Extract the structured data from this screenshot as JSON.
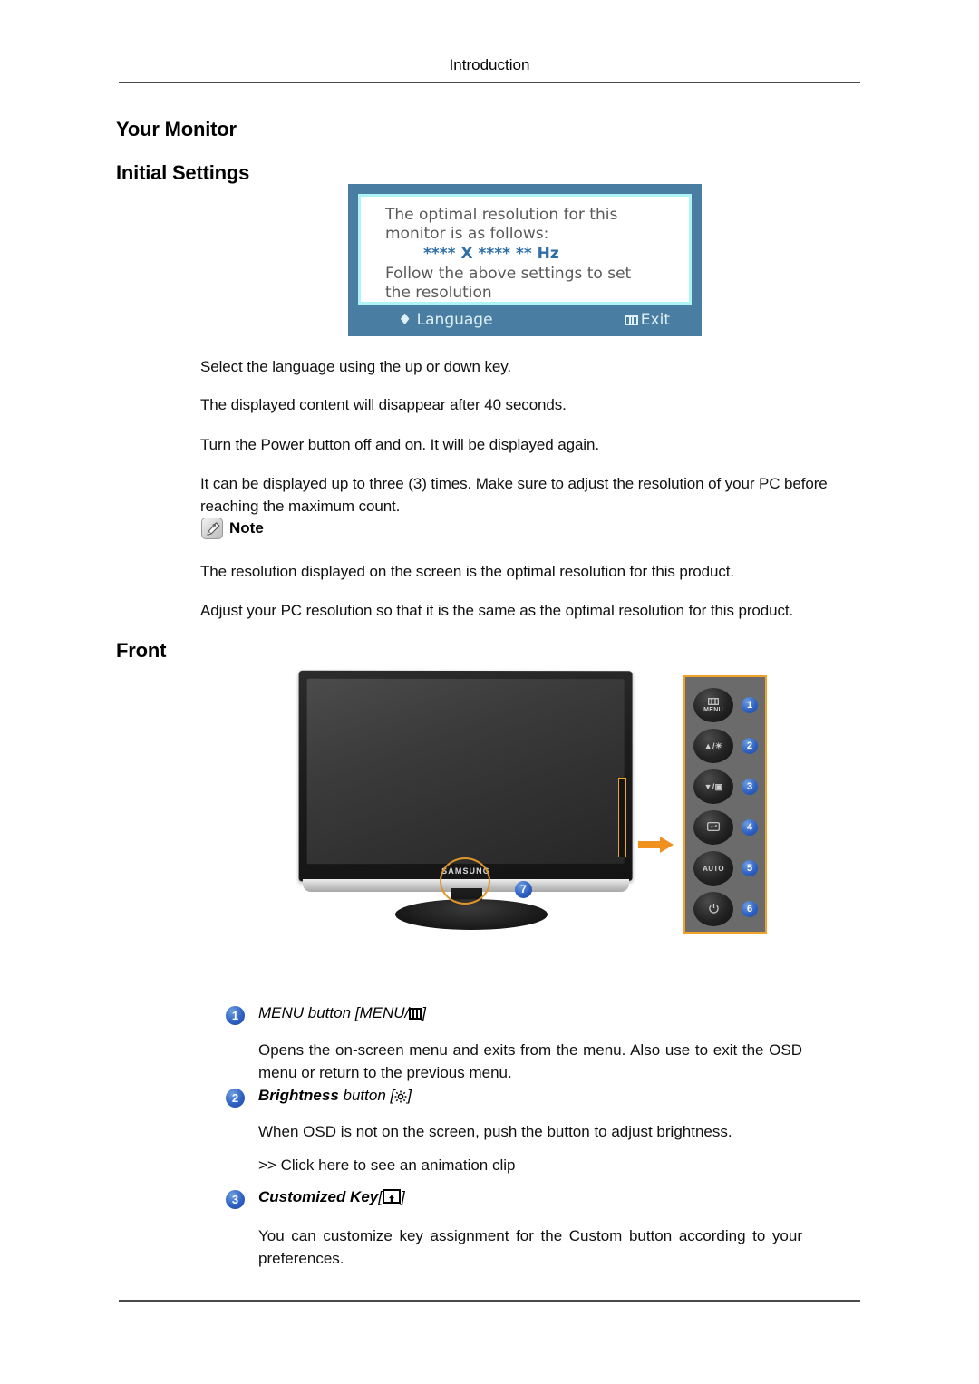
{
  "header": {
    "running_title": "Introduction"
  },
  "headings": {
    "your_monitor": "Your Monitor",
    "initial_settings": "Initial Settings",
    "front": "Front"
  },
  "osd": {
    "line1": "The optimal resolution for this",
    "line2": "monitor is as follows:",
    "resolution": "**** X **** ** Hz",
    "line3": "Follow the above settings to set",
    "line4": "the resolution",
    "language_label": "Language",
    "exit_label": "Exit",
    "frame_color": "#4a7da2",
    "inner_border_color": "#aef3f6",
    "text_color": "#595959",
    "resolution_color": "#2f6fa8"
  },
  "body": {
    "select_language": "Select the language using the up or down key.",
    "disappear": "The displayed content will disappear after 40 seconds.",
    "power_button": "Turn the Power button off and on. It will be displayed again.",
    "three_times": "It can be displayed up to three (3) times. Make sure to adjust the resolution of your PC before reaching the maximum count.",
    "note_label": "Note",
    "note_icon": "note-pen-icon",
    "note_line_1": "The resolution displayed on the screen is the optimal resolution for this product.",
    "note_line_2": "Adjust your PC resolution so that it is the same as the optimal resolution for this product."
  },
  "figure": {
    "brand_logo": "SAMSUNG",
    "callout_badge": "7",
    "arrow_color": "#f0901e",
    "highlight_color": "#f0a22a",
    "badge_color": "#2f62c4",
    "panel_buttons": [
      {
        "number": "1",
        "label": "MENU",
        "icon": "menu-icon"
      },
      {
        "number": "2",
        "label": "▲ / ☀",
        "icon": "up-brightness-icon"
      },
      {
        "number": "3",
        "label": "▼ / ▣",
        "icon": "down-customized-icon"
      },
      {
        "number": "4",
        "label": "↵",
        "icon": "enter-icon"
      },
      {
        "number": "5",
        "label": "AUTO",
        "icon": "auto-icon"
      },
      {
        "number": "6",
        "label": "⏻",
        "icon": "power-icon"
      }
    ]
  },
  "items": [
    {
      "number": "1",
      "title_plain": "MENU button [MENU/",
      "title_tail": "]",
      "icon": "menu-bars-icon",
      "body": "Opens the on-screen menu and exits from the menu. Also use to exit the OSD menu or return to the previous menu."
    },
    {
      "number": "2",
      "title_bold": "Brightness",
      "title_plain": " button [",
      "title_tail": "]",
      "icon": "sun-brightness-icon",
      "body": "When OSD is not on the screen, push the button to adjust brightness.",
      "link": ">> Click here to see an animation clip"
    },
    {
      "number": "3",
      "title_bold": "Customized Key",
      "title_plain": "[",
      "title_tail": "]",
      "icon": "box-up-arrow-icon",
      "body": "You can customize key assignment for the Custom button according to your preferences."
    }
  ]
}
